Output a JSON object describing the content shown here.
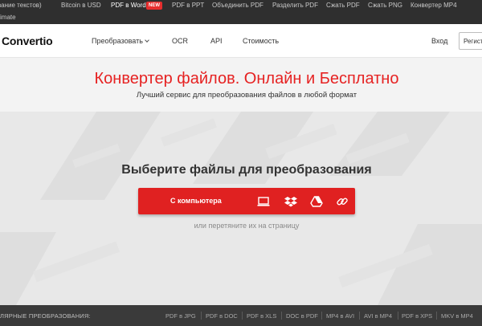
{
  "topbar": {
    "links": [
      {
        "label": "вание текстов)",
        "active": false
      },
      {
        "label": "Bitcoin в USD",
        "active": false
      },
      {
        "label": "PDF в Word",
        "active": true
      },
      {
        "label": "PDF в PPT",
        "active": false
      },
      {
        "label": "Объединить PDF",
        "active": false
      },
      {
        "label": "Разделить PDF",
        "active": false
      },
      {
        "label": "Сжать PDF",
        "active": false
      },
      {
        "label": "Сжать PNG",
        "active": false
      },
      {
        "label": "Конвертер MP4",
        "active": false
      }
    ],
    "new_badge": "NEW",
    "row2_text": "imate"
  },
  "header": {
    "logo": "Convertio",
    "nav": {
      "convert": "Преобразовать",
      "ocr": "OCR",
      "api": "API",
      "pricing": "Стоимость",
      "login": "Вход",
      "signup": "Регистрация"
    }
  },
  "hero": {
    "title": "Конвертер файлов. Онлайн и Бесплатно",
    "subtitle": "Лучший сервис для преобразования файлов в любой формат"
  },
  "upload": {
    "title": "Выберите файлы для преобразования",
    "button_label": "С компьютера",
    "icons": [
      "computer-icon",
      "dropbox-icon",
      "google-drive-icon",
      "link-icon"
    ],
    "hint": "или перетяните их на страницу"
  },
  "bottombar": {
    "label": "ЛЯРНЫЕ ПРЕОБРАЗОВАНИЯ:",
    "conversions": [
      "PDF в JPG",
      "PDF в DOC",
      "PDF в XLS",
      "DOC в PDF",
      "MP4 в AVI",
      "AVI в MP4",
      "PDF в XPS",
      "MKV в MP4"
    ]
  },
  "colors": {
    "accent": "#e02121",
    "topbar": "#2f2f2f",
    "bottombar": "#3a3a3a"
  }
}
